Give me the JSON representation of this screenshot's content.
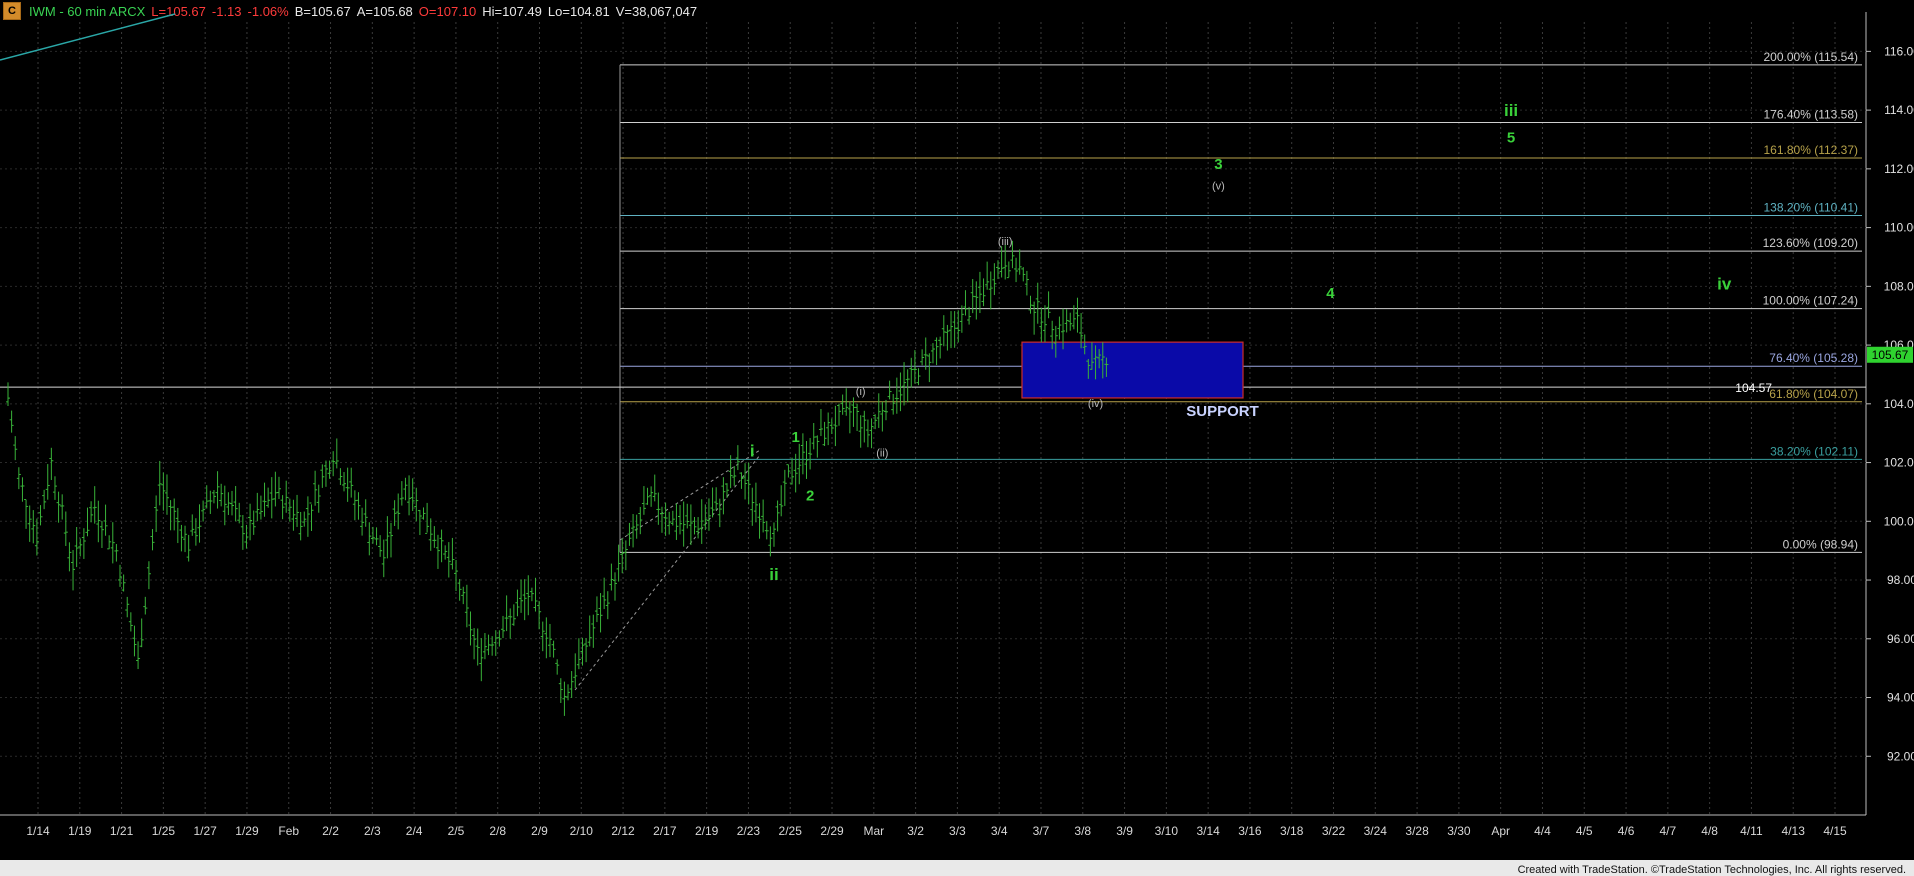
{
  "header": {
    "icon_letter": "C",
    "symbol": "IWM - 60 min  ARCX",
    "last": "L=105.67",
    "change": "-1.13",
    "change_pct": "-1.06%",
    "bid": "B=105.67",
    "ask": "A=105.68",
    "open": "O=107.10",
    "high": "Hi=107.49",
    "low": "Lo=104.81",
    "volume": "V=38,067,047"
  },
  "footer": {
    "credit": "Created with TradeStation. ©TradeStation Technologies, Inc. All rights reserved."
  },
  "chart_data": {
    "type": "candlestick",
    "title": "",
    "xlabel": "",
    "ylabel": "",
    "ylim": [
      90.0,
      117.0
    ],
    "yticks": [
      92,
      94,
      96,
      98,
      100,
      102,
      104,
      106,
      108,
      110,
      112,
      114,
      116
    ],
    "ytick_labels": [
      "92.00",
      "94.00",
      "96.00",
      "98.00",
      "100.00",
      "102.00",
      "104.00",
      "106.00",
      "108.00",
      "110.00",
      "112.00",
      "114.00",
      "116.00"
    ],
    "xtick_labels": [
      "1/14",
      "1/19",
      "1/21",
      "1/25",
      "1/27",
      "1/29",
      "Feb",
      "2/2",
      "2/3",
      "2/4",
      "2/5",
      "2/8",
      "2/9",
      "2/10",
      "2/12",
      "2/17",
      "2/19",
      "2/23",
      "2/25",
      "2/29",
      "Mar",
      "3/2",
      "3/3",
      "3/4",
      "3/7",
      "3/8",
      "3/9",
      "3/10",
      "3/14",
      "3/16",
      "3/18",
      "3/22",
      "3/24",
      "3/28",
      "3/30",
      "Apr",
      "4/4",
      "4/5",
      "4/6",
      "4/7",
      "4/8",
      "4/11",
      "4/13",
      "4/15"
    ],
    "last_price_label": "105.67",
    "last_price": 105.67,
    "price_points": [
      {
        "bar": 0,
        "v": 104.2
      },
      {
        "bar": 3,
        "v": 101.5
      },
      {
        "bar": 8,
        "v": 99.5
      },
      {
        "bar": 12,
        "v": 102.0
      },
      {
        "bar": 18,
        "v": 98.5
      },
      {
        "bar": 24,
        "v": 100.5
      },
      {
        "bar": 30,
        "v": 99.0
      },
      {
        "bar": 36,
        "v": 95.2
      },
      {
        "bar": 42,
        "v": 101.3
      },
      {
        "bar": 50,
        "v": 99.2
      },
      {
        "bar": 58,
        "v": 101.2
      },
      {
        "bar": 66,
        "v": 99.6
      },
      {
        "bar": 74,
        "v": 101.0
      },
      {
        "bar": 82,
        "v": 100.0
      },
      {
        "bar": 90,
        "v": 102.3
      },
      {
        "bar": 98,
        "v": 100.2
      },
      {
        "bar": 104,
        "v": 98.8
      },
      {
        "bar": 110,
        "v": 101.3
      },
      {
        "bar": 118,
        "v": 99.5
      },
      {
        "bar": 124,
        "v": 98.2
      },
      {
        "bar": 130,
        "v": 95.5
      },
      {
        "bar": 138,
        "v": 96.5
      },
      {
        "bar": 144,
        "v": 97.5
      },
      {
        "bar": 150,
        "v": 96.0
      },
      {
        "bar": 154,
        "v": 94.0
      },
      {
        "bar": 160,
        "v": 95.8
      },
      {
        "bar": 166,
        "v": 97.5
      },
      {
        "bar": 172,
        "v": 99.3
      },
      {
        "bar": 178,
        "v": 100.8
      },
      {
        "bar": 184,
        "v": 100.0
      },
      {
        "bar": 190,
        "v": 99.8
      },
      {
        "bar": 196,
        "v": 100.4
      },
      {
        "bar": 202,
        "v": 101.8
      },
      {
        "bar": 206,
        "v": 100.8
      },
      {
        "bar": 212,
        "v": 99.5
      },
      {
        "bar": 216,
        "v": 101.5
      },
      {
        "bar": 222,
        "v": 102.5
      },
      {
        "bar": 228,
        "v": 103.3
      },
      {
        "bar": 234,
        "v": 103.8
      },
      {
        "bar": 238,
        "v": 103.0
      },
      {
        "bar": 242,
        "v": 103.9
      },
      {
        "bar": 248,
        "v": 104.6
      },
      {
        "bar": 254,
        "v": 105.5
      },
      {
        "bar": 260,
        "v": 106.3
      },
      {
        "bar": 266,
        "v": 107.2
      },
      {
        "bar": 272,
        "v": 108.2
      },
      {
        "bar": 276,
        "v": 108.9
      },
      {
        "bar": 280,
        "v": 108.6
      },
      {
        "bar": 284,
        "v": 107.3
      },
      {
        "bar": 290,
        "v": 106.6
      },
      {
        "bar": 296,
        "v": 106.8
      },
      {
        "bar": 300,
        "v": 105.2
      },
      {
        "bar": 304,
        "v": 105.6
      }
    ],
    "total_bars": 305,
    "fib_levels": [
      {
        "label": "200.00% (115.54)",
        "value": 115.54,
        "color": "#cfcfcf"
      },
      {
        "label": "176.40% (113.58)",
        "value": 113.58,
        "color": "#cfcfcf"
      },
      {
        "label": "161.80% (112.37)",
        "value": 112.37,
        "color": "#b7a24a"
      },
      {
        "label": "138.20% (110.41)",
        "value": 110.41,
        "color": "#5fb2c2"
      },
      {
        "label": "123.60% (109.20)",
        "value": 109.2,
        "color": "#cfcfcf"
      },
      {
        "label": "100.00% (107.24)",
        "value": 107.24,
        "color": "#cfcfcf"
      },
      {
        "label": "76.40% (105.28)",
        "value": 105.28,
        "color": "#9aa6e0"
      },
      {
        "label": "61.80% (104.07)",
        "value": 104.07,
        "color": "#b7a24a"
      },
      {
        "label": "38.20% (102.11)",
        "value": 102.11,
        "color": "#3aa0a0"
      },
      {
        "label": "0.00% (98.94)",
        "value": 98.94,
        "color": "#cfcfcf"
      }
    ],
    "horizontal_line": {
      "label": "104.57",
      "value": 104.57
    },
    "support_zone": {
      "label": "SUPPORT",
      "y_low": 104.2,
      "y_high": 106.1,
      "fill": "#0a0aa8",
      "border": "#cc2b2b"
    },
    "wave_labels": [
      {
        "text": "i",
        "bar": 206,
        "v": 102.2,
        "color": "#3ad13a",
        "size": "lg"
      },
      {
        "text": "ii",
        "bar": 212,
        "v": 98.0,
        "color": "#3ad13a",
        "size": "lg"
      },
      {
        "text": "1",
        "bar": 218,
        "v": 102.7,
        "color": "#3ad13a",
        "size": "md"
      },
      {
        "text": "2",
        "bar": 222,
        "v": 100.7,
        "color": "#3ad13a",
        "size": "md"
      },
      {
        "text": "(i)",
        "bar": 236,
        "v": 104.3,
        "color": "#bbbbbb",
        "size": "sm"
      },
      {
        "text": "(ii)",
        "bar": 242,
        "v": 102.2,
        "color": "#bbbbbb",
        "size": "sm"
      },
      {
        "text": "(iii)",
        "bar": 276,
        "v": 109.4,
        "color": "#bbbbbb",
        "size": "sm"
      },
      {
        "text": "(iv)",
        "bar": 301,
        "v": 103.9,
        "color": "#bbbbbb",
        "size": "sm"
      },
      {
        "text": "3",
        "bar": 335,
        "v": 112.0,
        "color": "#3ad13a",
        "size": "md"
      },
      {
        "text": "(v)",
        "bar": 335,
        "v": 111.3,
        "color": "#bbbbbb",
        "size": "sm"
      },
      {
        "text": "4",
        "bar": 366,
        "v": 107.6,
        "color": "#3ad13a",
        "size": "md"
      },
      {
        "text": "iii",
        "bar": 416,
        "v": 113.8,
        "color": "#3ad13a",
        "size": "lg"
      },
      {
        "text": "5",
        "bar": 416,
        "v": 112.9,
        "color": "#3ad13a",
        "size": "md"
      },
      {
        "text": "iv",
        "bar": 475,
        "v": 107.9,
        "color": "#3ad13a",
        "size": "lg"
      }
    ]
  }
}
